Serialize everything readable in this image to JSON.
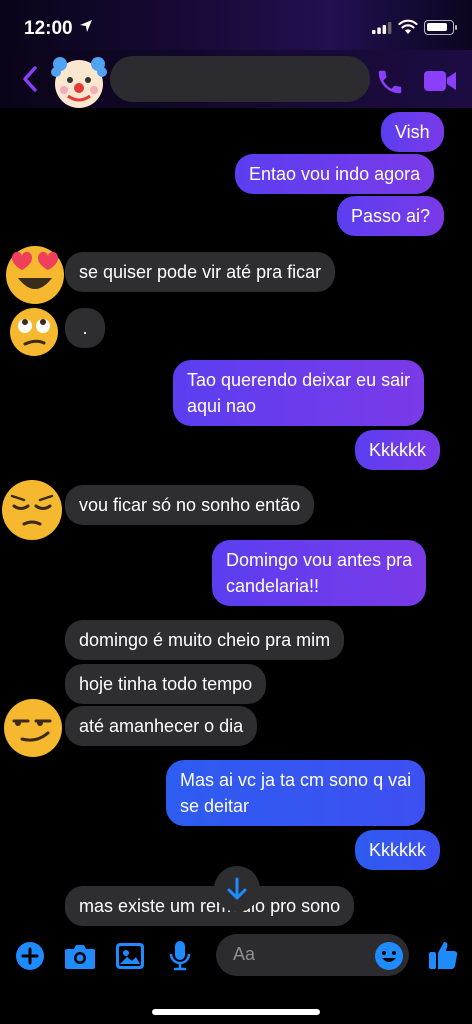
{
  "status_bar": {
    "time": "12:00"
  },
  "header": {
    "contact_name": ""
  },
  "messages": [
    {
      "from": "me",
      "text": "Vish"
    },
    {
      "from": "me",
      "text": "Entao vou indo agora"
    },
    {
      "from": "me",
      "text": "Passo ai?"
    },
    {
      "from": "them",
      "text": "se quiser pode vir até pra ficar"
    },
    {
      "from": "them",
      "text": "."
    },
    {
      "from": "me",
      "text_line1": "Tao querendo deixar eu sair",
      "text_line2": "aqui nao"
    },
    {
      "from": "me",
      "text": "Kkkkkk"
    },
    {
      "from": "them",
      "text": "vou ficar só no sonho então"
    },
    {
      "from": "me",
      "text_line1": "Domingo vou antes pra",
      "text_line2": "candelaria!!"
    },
    {
      "from": "them",
      "text": "domingo é muito cheio pra mim"
    },
    {
      "from": "them",
      "text": "hoje tinha todo tempo"
    },
    {
      "from": "them",
      "text": "até amanhecer o dia"
    },
    {
      "from": "me",
      "text_line1": "Mas ai vc ja ta cm sono q vai",
      "text_line2": "se deitar"
    },
    {
      "from": "me",
      "text": "Kkkkkk"
    },
    {
      "from": "them",
      "text": "mas existe um remedio pro sono"
    }
  ],
  "composer": {
    "placeholder": "Aa"
  },
  "colors": {
    "accent": "#8a3ffc",
    "composer_icon": "#1e8bff"
  },
  "icons": {
    "reaction_avatars": [
      "heart-eyes-emoji",
      "rolling-eyes-emoji",
      "pensive-emoji",
      "smirk-emoji"
    ],
    "header_avatar": "clown-emoji"
  }
}
